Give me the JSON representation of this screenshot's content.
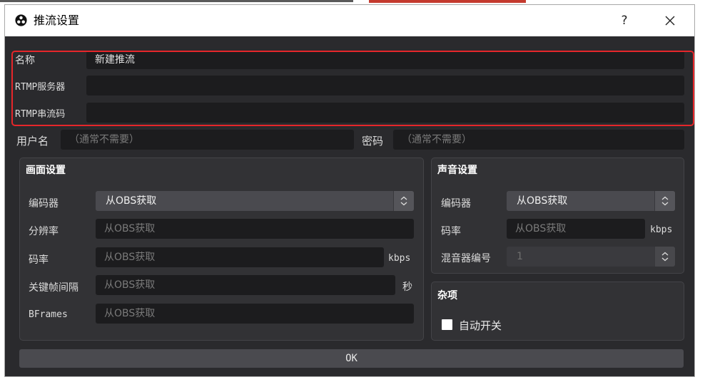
{
  "window": {
    "title": "推流设置",
    "help_glyph": "?",
    "close_glyph": "✕"
  },
  "stream": {
    "name_label": "名称",
    "name_value": "新建推流",
    "server_label": "RTMP服务器",
    "server_value": "",
    "key_label": "RTMP串流码",
    "key_value": "",
    "username_label": "用户名",
    "username_placeholder": "（通常不需要）",
    "password_label": "密码",
    "password_placeholder": "（通常不需要）"
  },
  "video": {
    "title": "画面设置",
    "encoder_label": "编码器",
    "encoder_value": "从OBS获取",
    "resolution_label": "分辨率",
    "resolution_value": "从OBS获取",
    "bitrate_label": "码率",
    "bitrate_value": "从OBS获取",
    "bitrate_unit": "kbps",
    "keyframe_label": "关键帧间隔",
    "keyframe_value": "从OBS获取",
    "keyframe_unit": "秒",
    "bframes_label": "BFrames",
    "bframes_value": "从OBS获取"
  },
  "audio": {
    "title": "声音设置",
    "encoder_label": "编码器",
    "encoder_value": "从OBS获取",
    "bitrate_label": "码率",
    "bitrate_value": "从OBS获取",
    "bitrate_unit": "kbps",
    "mixer_label": "混音器编号",
    "mixer_value": "1"
  },
  "misc": {
    "title": "杂项",
    "autostart_label": "自动开关",
    "autostart_checked": false
  },
  "ok_label": "OK",
  "colors": {
    "background": "#2a2a2d",
    "field": "#1c1c1e",
    "highlight_border": "#e6262a"
  }
}
